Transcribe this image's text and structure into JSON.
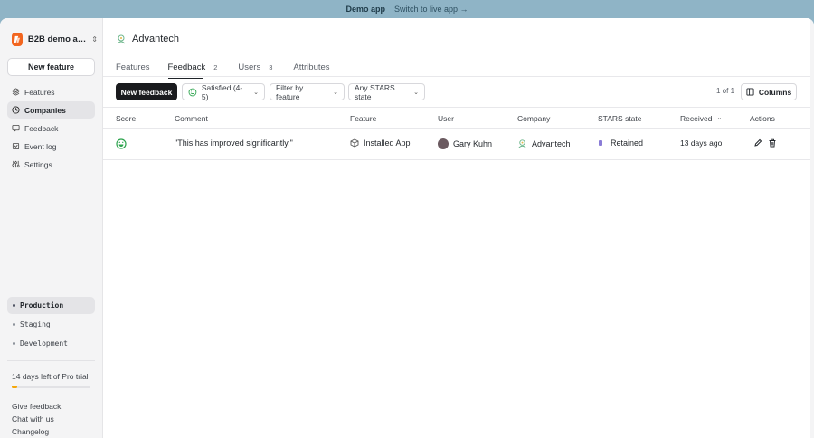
{
  "banner": {
    "title": "Demo app",
    "link": "Switch to live app →"
  },
  "sidebar": {
    "org_name": "B2B demo a…",
    "new_feature_label": "New feature",
    "nav": [
      {
        "label": "Features",
        "icon": "features-icon"
      },
      {
        "label": "Companies",
        "icon": "companies-icon",
        "active": true
      },
      {
        "label": "Feedback",
        "icon": "feedback-icon"
      },
      {
        "label": "Event log",
        "icon": "event-log-icon"
      },
      {
        "label": "Settings",
        "icon": "settings-icon"
      }
    ],
    "environments": [
      {
        "label": "Production",
        "active": true
      },
      {
        "label": "Staging"
      },
      {
        "label": "Development"
      }
    ],
    "trial_text": "14 days left of Pro trial",
    "trial_progress": 0.07,
    "footer_links": [
      "Give feedback",
      "Chat with us",
      "Changelog"
    ]
  },
  "main": {
    "company_name": "Advantech",
    "tabs": [
      {
        "label": "Features",
        "count": ""
      },
      {
        "label": "Feedback",
        "count": "2",
        "active": true
      },
      {
        "label": "Users",
        "count": "3"
      },
      {
        "label": "Attributes",
        "count": ""
      }
    ],
    "toolbar": {
      "new_feedback": "New feedback",
      "satisfaction_filter": "Satisfied (4-5)",
      "feature_filter": "Filter by feature",
      "stars_filter": "Any STARS state",
      "pager": "1 of 1",
      "columns": "Columns"
    },
    "table": {
      "headers": [
        "Score",
        "Comment",
        "Feature",
        "User",
        "Company",
        "STARS state",
        "Received",
        "Actions"
      ],
      "rows": [
        {
          "score": "satisfied",
          "comment": "\"This has improved significantly.\"",
          "feature": "Installed App",
          "user": "Gary Kuhn",
          "company": "Advantech",
          "stars_state": "Retained",
          "received": "13 days ago"
        }
      ]
    }
  },
  "colors": {
    "banner": "#8fb4c6",
    "accent_orange": "#f2651f",
    "primary_button": "#1a1b1e",
    "trial_fill": "#f5a70a",
    "score_green": "#2da44e",
    "retained_purple": "#8a7cd6"
  }
}
